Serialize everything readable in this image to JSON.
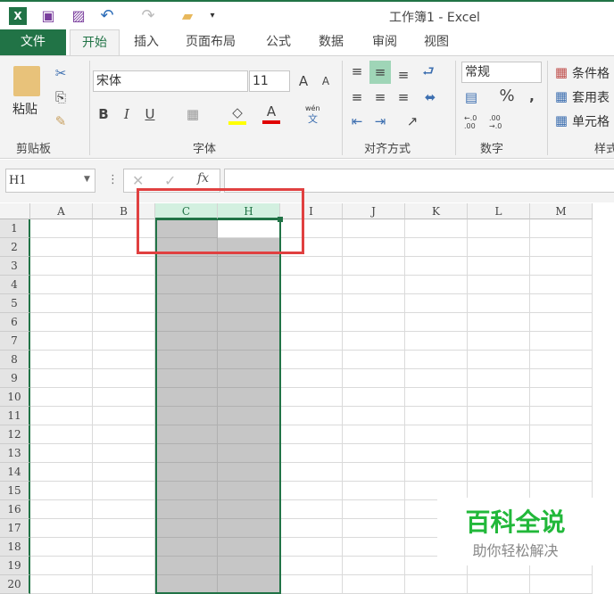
{
  "window": {
    "title": "工作簿1 - Excel"
  },
  "tabs": [
    "文件",
    "开始",
    "插入",
    "页面布局",
    "公式",
    "数据",
    "审阅",
    "视图"
  ],
  "ribbon": {
    "clipboard": {
      "paste": "粘贴",
      "group": "剪贴板"
    },
    "font": {
      "name": "宋体",
      "size": "11",
      "bold": "B",
      "italic": "I",
      "underline": "U",
      "phonetic_top": "wén",
      "phonetic_bottom": "文",
      "font_color": "A",
      "group": "字体"
    },
    "alignment": {
      "group": "对齐方式"
    },
    "number": {
      "format": "常规",
      "percent": "%",
      "comma": ",",
      "inc_decimal": "←.0 .00",
      "dec_decimal": ".00 →.0",
      "group": "数字"
    },
    "styles": {
      "conditional": "条件格",
      "table": "套用表",
      "cell": "单元格",
      "group": "样式"
    }
  },
  "formula_bar": {
    "name_box": "H1",
    "cancel": "✕",
    "enter": "✓",
    "fx": "fx",
    "value": ""
  },
  "sheet": {
    "columns": [
      "A",
      "B",
      "C",
      "H",
      "I",
      "J",
      "K",
      "L",
      "M"
    ],
    "selected_columns": [
      "C",
      "H"
    ],
    "active_cell": "H1",
    "rows": [
      "1",
      "2",
      "3",
      "4",
      "5",
      "6",
      "7",
      "8",
      "9",
      "10",
      "11",
      "12",
      "13",
      "14",
      "15",
      "16",
      "17",
      "18",
      "19",
      "20"
    ]
  },
  "watermark": {
    "title": "百科全说",
    "subtitle": "助你轻松解决"
  },
  "colors": {
    "accent": "#217346",
    "highlight": "#e04040",
    "watermark": "#22b83a"
  }
}
